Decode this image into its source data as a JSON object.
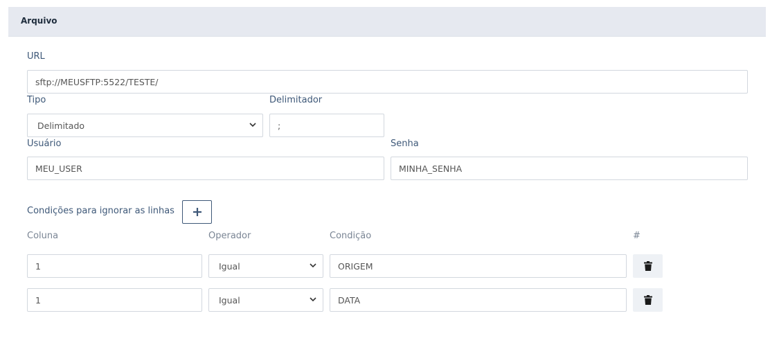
{
  "section": {
    "title": "Arquivo"
  },
  "url": {
    "label": "URL",
    "value": "sftp://MEUSFTP:5522/TESTE/"
  },
  "tipo": {
    "label": "Tipo",
    "value": "Delimitado"
  },
  "delimitador": {
    "label": "Delimitador",
    "value": ";"
  },
  "usuario": {
    "label": "Usuário",
    "value": "MEU_USER"
  },
  "senha": {
    "label": "Senha",
    "value": "MINHA_SENHA"
  },
  "conditions": {
    "label": "Condições para ignorar as linhas",
    "add_icon": "plus-icon",
    "columns": {
      "coluna": "Coluna",
      "operador": "Operador",
      "condicao": "Condição",
      "hash": "#"
    },
    "rows": [
      {
        "coluna": "1",
        "operador": "Igual",
        "condicao": "ORIGEM"
      },
      {
        "coluna": "1",
        "operador": "Igual",
        "condicao": "DATA"
      }
    ]
  },
  "icons": {
    "chevron": "chevron-down-icon",
    "delete": "trash-icon"
  },
  "colors": {
    "header_bg": "#e6e9f0",
    "accent": "#3e5878"
  }
}
